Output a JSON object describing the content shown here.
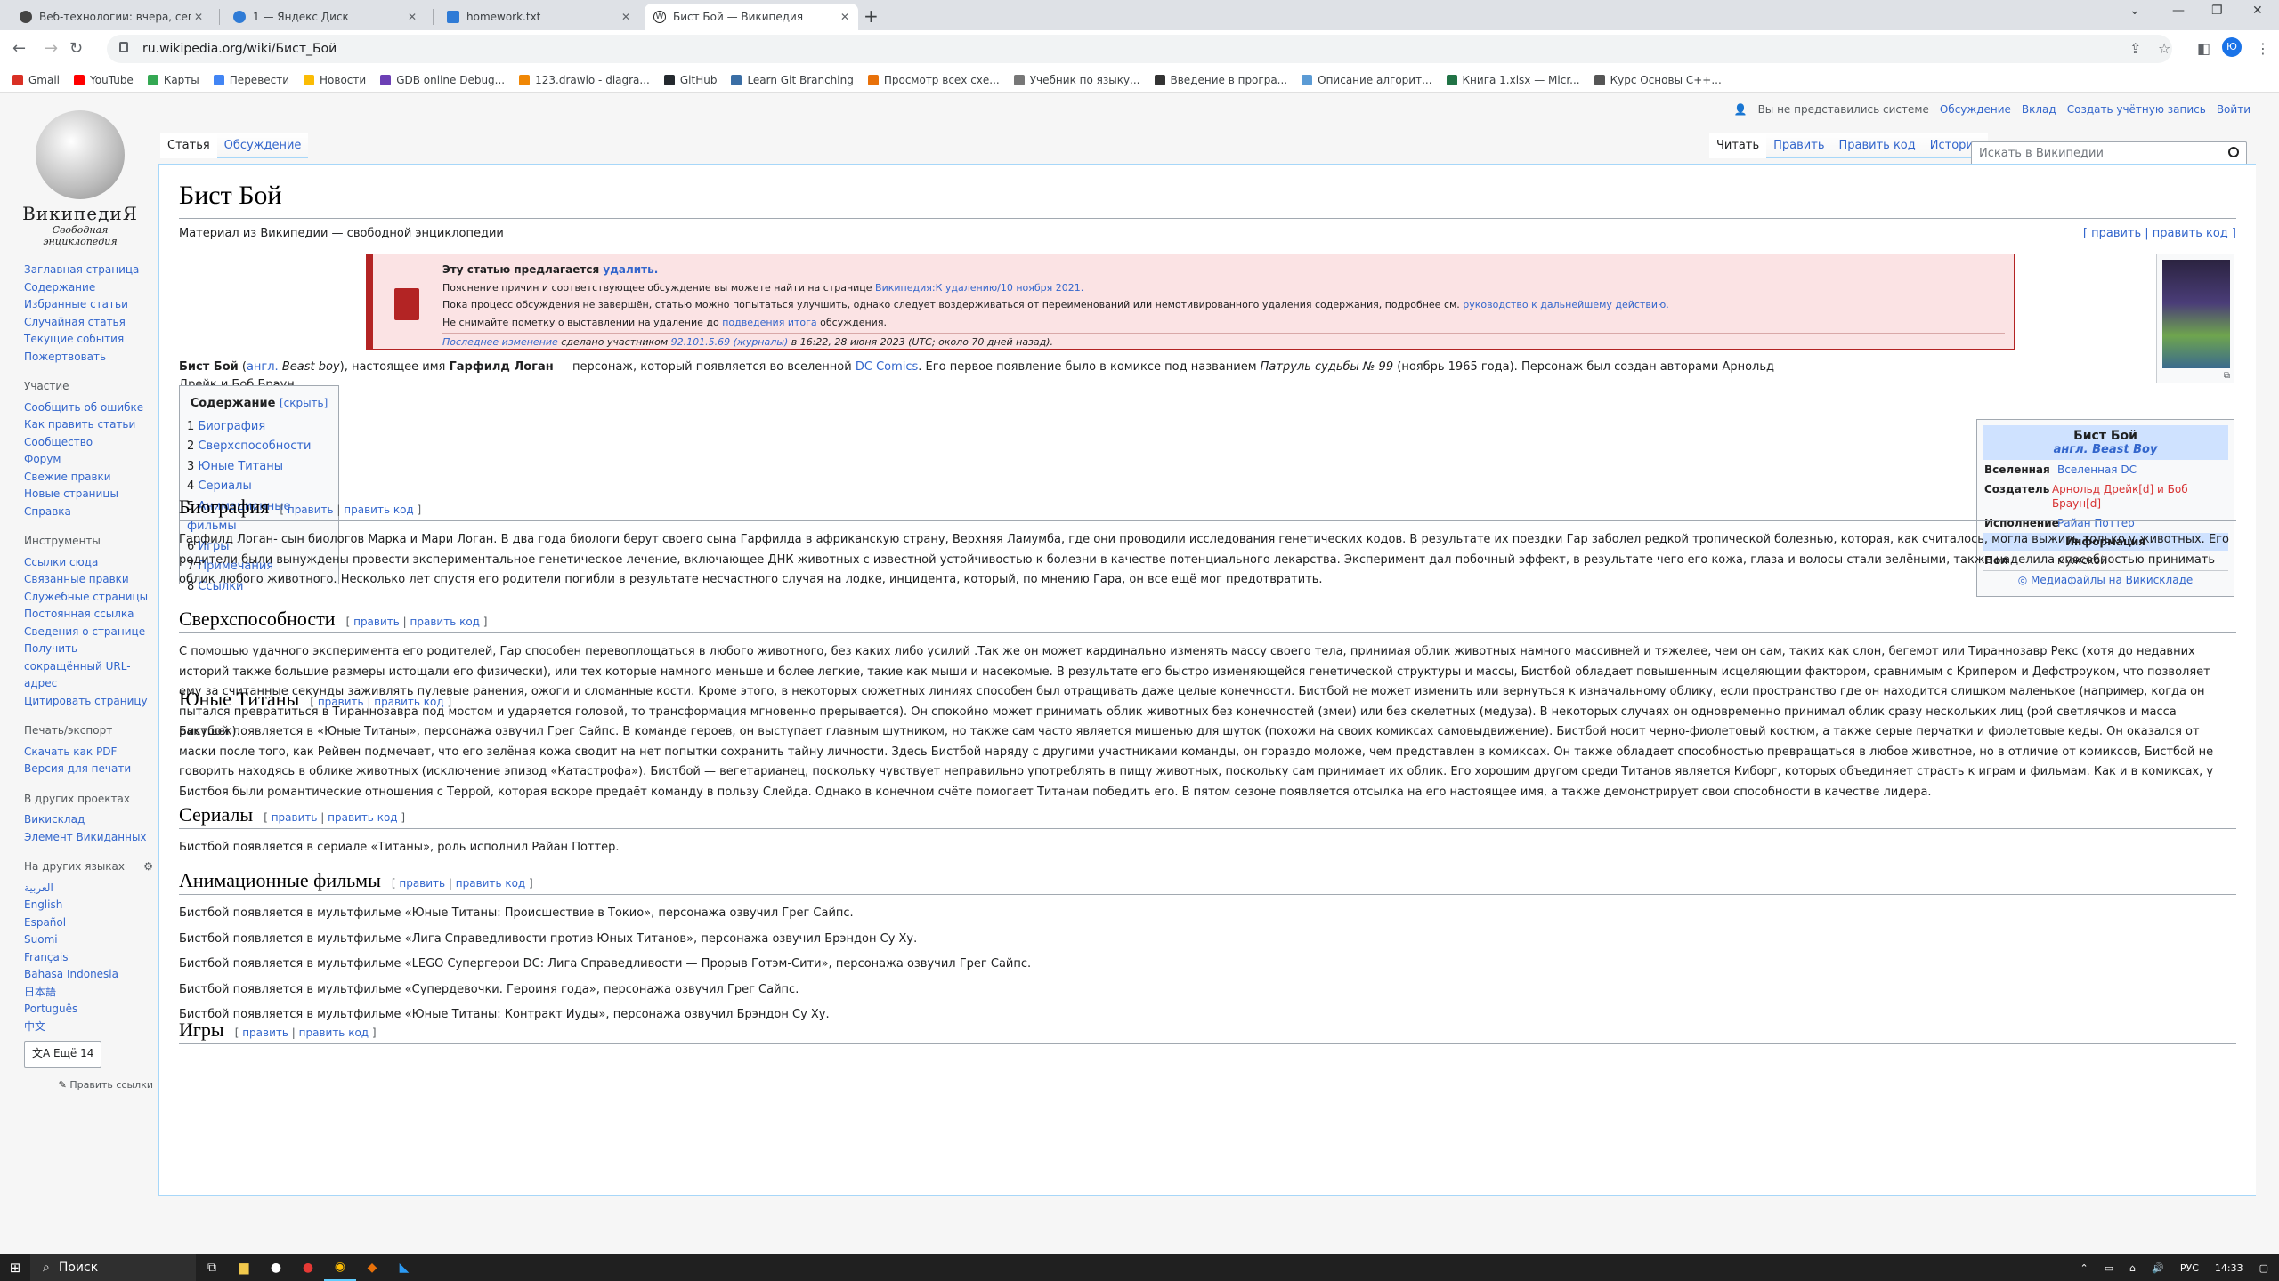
{
  "tabs": [
    {
      "title": "Веб-технологии: вчера, сегодня, завтра",
      "color": "#444"
    },
    {
      "title": "1 — Яндекс Диск",
      "color": "#2f7bd6"
    },
    {
      "title": "homework.txt",
      "color": "#2f7bd6"
    },
    {
      "title": "Бист Бой — Википедия",
      "color": "#222"
    }
  ],
  "address": "ru.wikipedia.org/wiki/Бист_Бой",
  "bookmarks": [
    {
      "label": "Gmail",
      "color": "#d93025"
    },
    {
      "label": "YouTube",
      "color": "#ff0000"
    },
    {
      "label": "Карты",
      "color": "#34a853"
    },
    {
      "label": "Перевести",
      "color": "#4285f4"
    },
    {
      "label": "Новости",
      "color": "#fbbc04"
    },
    {
      "label": "GDB online Debug...",
      "color": "#6c3fb5"
    },
    {
      "label": "123.drawio - diagra...",
      "color": "#f08705"
    },
    {
      "label": "GitHub",
      "color": "#24292e"
    },
    {
      "label": "Learn Git Branching",
      "color": "#3a6ea5"
    },
    {
      "label": "Просмотр всех схе...",
      "color": "#e8710a"
    },
    {
      "label": "Учебник по языку...",
      "color": "#777"
    },
    {
      "label": "Введение в програ...",
      "color": "#333"
    },
    {
      "label": "Описание алгорит...",
      "color": "#5b9bd5"
    },
    {
      "label": "Книга 1.xlsx — Micr...",
      "color": "#217346"
    },
    {
      "label": "Курс Основы C++...",
      "color": "#555"
    }
  ],
  "logo": {
    "title": "ВикипедиЯ",
    "subtitle": "Свободная энциклопедия"
  },
  "sidebar": {
    "nav": [
      "Заглавная страница",
      "Содержание",
      "Избранные статьи",
      "Случайная статья",
      "Текущие события",
      "Пожертвовать"
    ],
    "participation_head": "Участие",
    "participation": [
      "Сообщить об ошибке",
      "Как править статьи",
      "Сообщество",
      "Форум",
      "Свежие правки",
      "Новые страницы",
      "Справка"
    ],
    "tools_head": "Инструменты",
    "tools": [
      "Ссылки сюда",
      "Связанные правки",
      "Служебные страницы",
      "Постоянная ссылка",
      "Сведения о странице",
      "Получить сокращённый URL-адрес",
      "Цитировать страницу"
    ],
    "print_head": "Печать/экспорт",
    "print": [
      "Скачать как PDF",
      "Версия для печати"
    ],
    "projects_head": "В других проектах",
    "projects": [
      "Викисклад",
      "Элемент Викиданных"
    ],
    "langs_head": "На других языках",
    "langs": [
      "العربية",
      "English",
      "Español",
      "Suomi",
      "Français",
      "Bahasa Indonesia",
      "日本語",
      "Português",
      "中文"
    ],
    "more_langs": "Ещё 14",
    "edit_links": "Править ссылки"
  },
  "top_links": [
    "Вы не представились системе",
    "Обсуждение",
    "Вклад",
    "Создать учётную запись",
    "Войти"
  ],
  "page_tabs_left": [
    "Статья",
    "Обсуждение"
  ],
  "page_tabs_right": [
    "Читать",
    "Править",
    "Править код",
    "История"
  ],
  "search_placeholder": "Искать в Википедии",
  "title": "Бист Бой",
  "subtitle": "Материал из Википедии — свободной энциклопедии",
  "edit_top": "[ править | править код ]",
  "warning": {
    "line1_a": "Эту статью предлагается ",
    "line1_link": "удалить.",
    "line2_a": "Пояснение причин и соответствующее обсуждение вы можете найти на странице ",
    "line2_link": "Википедия:К удалению/10 ноября 2021.",
    "line3_a": "Пока процесс обсуждения не завершён, статью можно попытаться улучшить, однако следует воздерживаться от переименований или немотивированного удаления содержания, подробнее см. ",
    "line3_link": "руководство к дальнейшему действию.",
    "line4_a": "Не снимайте пометку о выставлении на удаление до ",
    "line4_link": "подведения итога",
    "line4_b": " обсуждения.",
    "line5_link": "Последнее изменение",
    "line5_b": " сделано участником ",
    "line5_user": "92.101.5.69 (журналы)",
    "line5_c": " в 16:22, 28 июня 2023 (UTC; около 70 дней назад)."
  },
  "lede": {
    "bold1": "Бист Бой",
    "a": " (",
    "link_lang": "англ.",
    "en": " Beast boy",
    "b": "), настоящее имя ",
    "bold2": "Гарфилд Логан",
    "c": " — персонаж, который появляется во вселенной ",
    "link_dc": "DC Comics",
    "d": ". Его первое появление было в комиксе под названием ",
    "ital": "Патруль судьбы № 99",
    "e": " (ноябрь 1965 года). Персонаж был создан авторами Арнольд Дрейк и Боб Браун."
  },
  "toc": {
    "title": "Содержание",
    "hide": "[скрыть]",
    "items": [
      "Биография",
      "Сверхспособности",
      "Юные Титаны",
      "Сериалы",
      "Анимационные фильмы",
      "Игры",
      "Примечания",
      "Ссылки"
    ]
  },
  "infobox": {
    "title": "Бист Бой",
    "title_en": "англ. Beast Boy",
    "rows": [
      {
        "k": "Вселенная",
        "v": "Вселенная DC"
      },
      {
        "k": "Создатель",
        "v": "Арнольд Дрейк[d] и Боб Браун[d]"
      },
      {
        "k": "Исполнение",
        "v": "Райан Поттер"
      }
    ],
    "info_head": "Информация",
    "gender_k": "Пол",
    "gender_v": "мужской",
    "commons": "Медиафайлы на Викискладе"
  },
  "edit_links": {
    "edit": "править",
    "edit_code": "править код"
  },
  "sections": [
    {
      "h": "Биография",
      "p": [
        "Гарфилд Логан- сын биологов Марка и Мари Логан. В два года биологи берут своего сына Гарфилда в африканскую страну, Верхняя Ламумба, где они проводили исследования генетических кодов. В результате их поездки Гар заболел редкой тропической болезнью, которая, как считалось, могла выжить только у животных. Его родители были вынуждены провести экспериментальное генетическое лечение, включающее ДНК животных с известной устойчивостью к болезни в качестве потенциального лекарства. Эксперимент дал побочный эффект, в результате чего его кожа, глаза и волосы стали зелёными, также наделила способностью принимать облик любого животного. Несколько лет спустя его родители погибли в результате несчастного случая на лодке, инцидента, который, по мнению Гара, он все ещё мог предотвратить."
      ]
    },
    {
      "h": "Сверхспособности",
      "p": [
        "С помощью удачного эксперимента его родителей, Гар способен перевоплощаться в любого животного, без каких либо усилий .Так же он может кардинально изменять массу своего тела, принимая облик животных намного массивней и тяжелее, чем он сам, таких как слон, бегемот или Тираннозавр Рекс (хотя до недавних историй также большие размеры истощали его физически), или тех которые намного меньше и более легкие, такие как мыши и насекомые. В результате его быстро изменяющейся генетической структуры и массы, Бистбой обладает повышенным исцеляющим фактором, сравнимым с Крипером и Дефстроуком, что позволяет ему за считанные секунды заживлять пулевые ранения, ожоги и сломанные кости. Кроме этого, в некоторых сюжетных линиях способен был отращивать даже целые конечности. Бистбой не может изменить или вернуться к изначальному облику, если пространство где он находится слишком маленькое (например, когда он пытался превратиться в Тираннозавра под мостом и ударяется головой, то трансформация мгновенно прерывается). Он спокойно может принимать облик животных без конечностей (змеи) или без скелетных (медуза). В некоторых случаях он одновременно принимал облик сразу нескольких лиц (рой светлячков и масса ракушек)."
      ]
    },
    {
      "h": "Юные Титаны",
      "p": [
        "Бистбой появляется в «Юные Титаны», персонажа озвучил Грег Сайпс. В команде героев, он выступает главным шутником, но также сам часто является мишенью для шуток (похожи на своих комиксах самовыдвижение). Бистбой носит черно-фиолетовый костюм, а также серые перчатки и фиолетовые кеды. Он оказался от маски после того, как Рейвен подмечает, что его зелёная кожа сводит на нет попытки сохранить тайну личности. Здесь Бистбой наряду с другими участниками команды, он гораздо моложе, чем представлен в комиксах. Он также обладает способностью превращаться в любое животное, но в отличие от комиксов, Бистбой не говорить находясь в облике животных (исключение эпизод «Катастрофа»). Бистбой — вегетарианец, поскольку чувствует неправильно употреблять в пищу животных, поскольку сам принимает их облик. Его хорошим другом среди Титанов является Киборг, которых объединяет страсть к играм и фильмам. Как и в комиксах, у Бистбоя были романтические отношения с Террой, которая вскоре предаёт команду в пользу Слейда. Однако в конечном счёте помогает Титанам победить его. В пятом сезоне появляется отсылка на его настоящее имя, а также демонстрирует свои способности в качестве лидера."
      ]
    },
    {
      "h": "Сериалы",
      "p": [
        "Бистбой появляется в сериале «Титаны», роль исполнил Райан Поттер."
      ]
    },
    {
      "h": "Анимационные фильмы",
      "p": [
        "Бистбой появляется в мультфильме «Юные Титаны: Происшествие в Токио», персонажа озвучил Грег Сайпс.",
        "Бистбой появляется в мультфильме «Лига Справедливости против Юных Титанов», персонажа озвучил Брэндон Су Ху.",
        "Бистбой появляется в мультфильме «LEGO Супергерои DC: Лига Справедливости — Прорыв Готэм-Сити», персонажа озвучил Грег Сайпс.",
        "Бистбой появляется в мультфильме «Супердевочки. Героиня года», персонажа озвучил Грег Сайпс.",
        "Бистбой появляется в мультфильме «Юные Титаны: Контракт Иуды», персонажа озвучил Брэндон Су Ху."
      ]
    },
    {
      "h": "Игры",
      "p": []
    }
  ],
  "taskbar": {
    "search": "Поиск",
    "lang": "РУС",
    "time": "14:33"
  }
}
